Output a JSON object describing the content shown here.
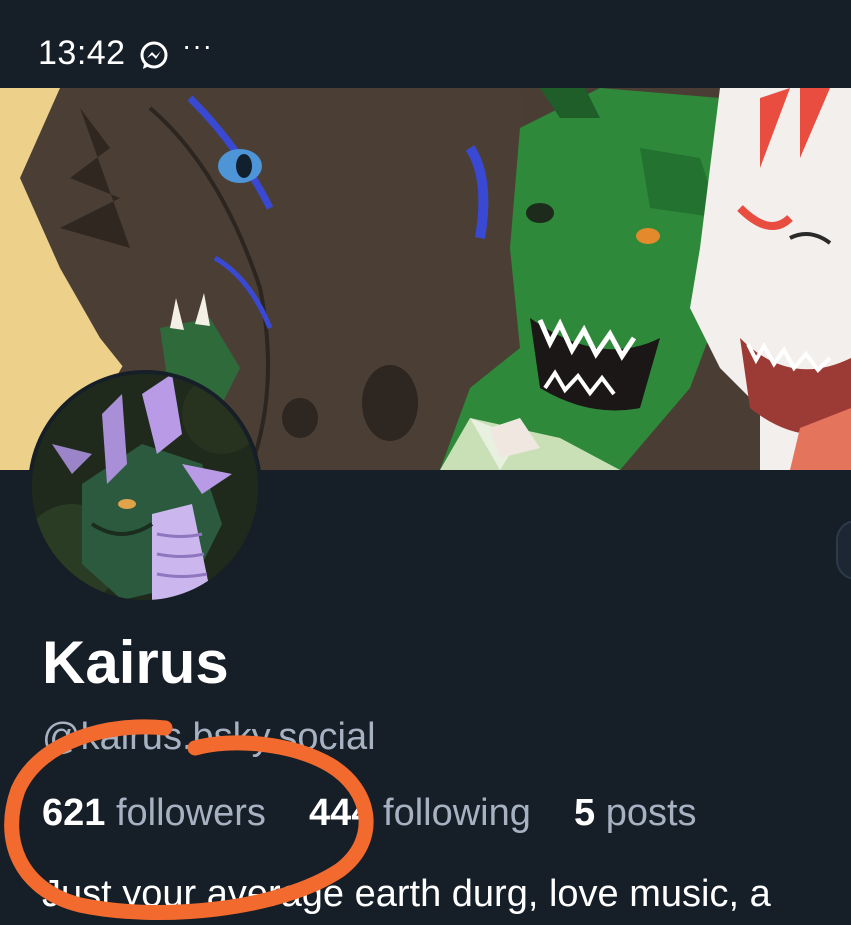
{
  "status_bar": {
    "time": "13:42",
    "messenger_icon": "messenger-icon",
    "more": "···"
  },
  "profile": {
    "display_name": "Kairus",
    "handle": "@kairus.bsky.social",
    "followers_count": "621",
    "followers_label": "followers",
    "following_count": "444",
    "following_label": "following",
    "posts_count": "5",
    "posts_label": "posts",
    "bio": "Just your average earth durg, love music, a"
  },
  "colors": {
    "background": "#161e27",
    "muted_text": "#a6b2c2",
    "annotation_circle": "#f26a2e"
  }
}
